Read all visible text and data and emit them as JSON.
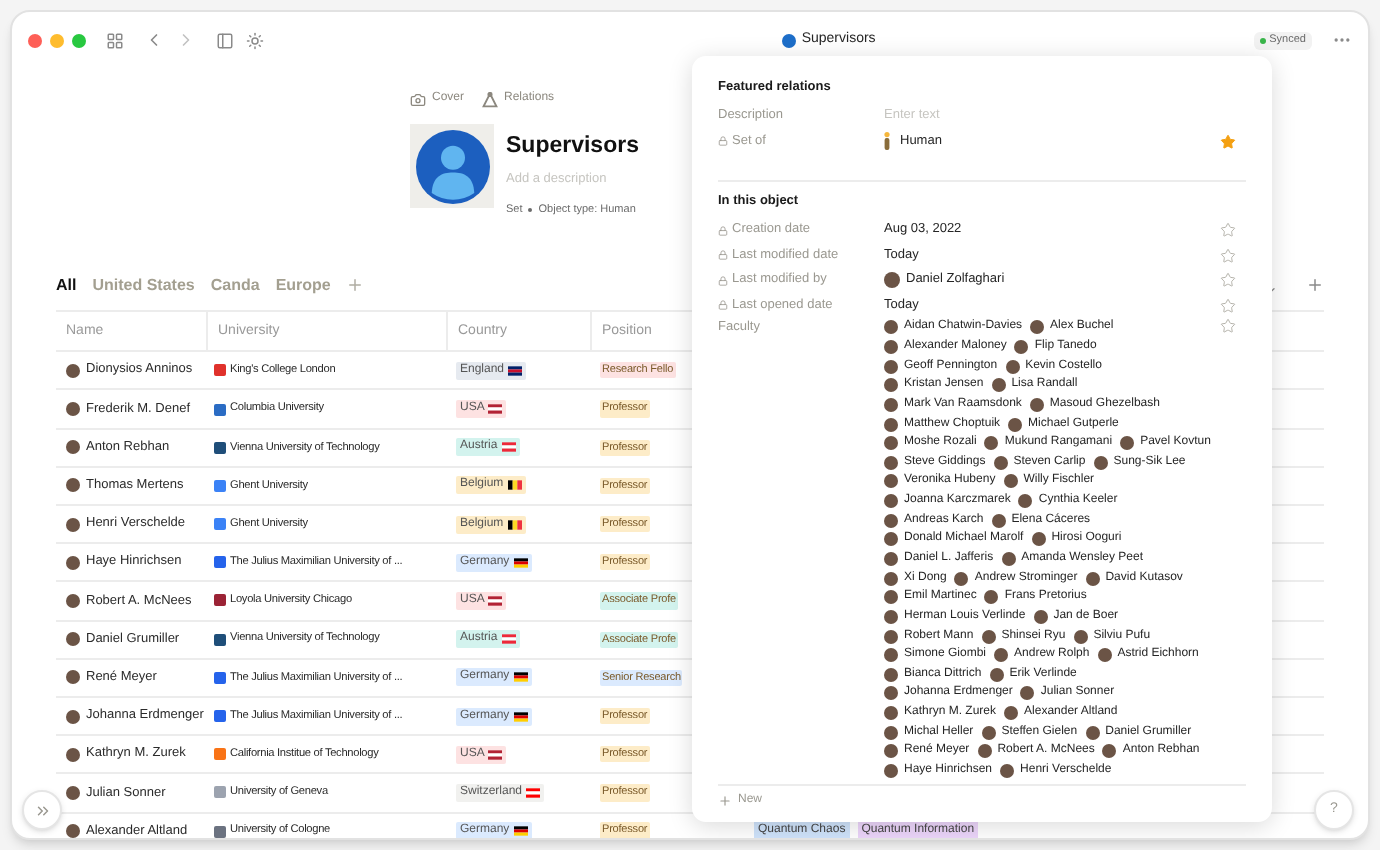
{
  "window": {
    "title": "Supervisors",
    "sync_status": "Synced"
  },
  "header": {
    "actions": [
      {
        "kind": "camera",
        "label": "Cover"
      },
      {
        "kind": "relations",
        "label": "Relations"
      }
    ],
    "title": "Supervisors",
    "description_placeholder": "Add a description",
    "type": "Set",
    "object_type": "Object type: Human"
  },
  "views": [
    {
      "label": "All",
      "selected": true
    },
    {
      "label": "United States",
      "selected": false
    },
    {
      "label": "Canda",
      "selected": false
    },
    {
      "label": "Europe",
      "selected": false
    }
  ],
  "table": {
    "columns": [
      "Name",
      "University",
      "Country",
      "Position"
    ],
    "rows": [
      {
        "name": "Dionysios Anninos",
        "university": {
          "label": "King's College London",
          "color": "#e0312b"
        },
        "country": {
          "label": "England",
          "color": "#e6eaf0",
          "flag": {
            "kind": "horizontal",
            "stripes": [
              {
                "color": "#012169"
              },
              {
                "color": "#c8102e"
              },
              {
                "color": "#012169"
              }
            ]
          }
        },
        "position": {
          "label": "Research Fello",
          "color": "#fde2e2"
        }
      },
      {
        "name": "Frederik M. Denef",
        "university": {
          "label": "Columbia University",
          "color": "#2a6cc4"
        },
        "country": {
          "label": "USA",
          "color": "#fde2e2",
          "flag": {
            "kind": "horizontal",
            "stripes": [
              {
                "color": "#b22234"
              },
              {
                "color": "#ffffff"
              },
              {
                "color": "#b22234"
              }
            ]
          }
        },
        "position": {
          "label": "Professor",
          "color": "#fdecc8"
        }
      },
      {
        "name": "Anton Rebhan",
        "university": {
          "label": "Vienna University of Technology",
          "color": "#1f4e79"
        },
        "country": {
          "label": "Austria",
          "color": "#d3f3ee",
          "flag": {
            "kind": "horizontal",
            "stripes": [
              {
                "color": "#ed2939"
              },
              {
                "color": "#ffffff"
              },
              {
                "color": "#ed2939"
              }
            ]
          }
        },
        "position": {
          "label": "Professor",
          "color": "#fdecc8"
        }
      },
      {
        "name": "Thomas Mertens",
        "university": {
          "label": "Ghent University",
          "color": "#3b82f6"
        },
        "country": {
          "label": "Belgium",
          "color": "#fdecc8",
          "flag": {
            "kind": "vertical",
            "stripes": [
              {
                "color": "#000000"
              },
              {
                "color": "#fdda24"
              },
              {
                "color": "#ef3340"
              }
            ]
          }
        },
        "position": {
          "label": "Professor",
          "color": "#fdecc8"
        }
      },
      {
        "name": "Henri Verschelde",
        "university": {
          "label": "Ghent University",
          "color": "#3b82f6"
        },
        "country": {
          "label": "Belgium",
          "color": "#fdecc8",
          "flag": {
            "kind": "vertical",
            "stripes": [
              {
                "color": "#000000"
              },
              {
                "color": "#fdda24"
              },
              {
                "color": "#ef3340"
              }
            ]
          }
        },
        "position": {
          "label": "Professor",
          "color": "#fdecc8"
        }
      },
      {
        "name": "Haye Hinrichsen",
        "university": {
          "label": "The Julius Maximilian University of ...",
          "color": "#2563eb"
        },
        "country": {
          "label": "Germany",
          "color": "#dbeafe",
          "flag": {
            "kind": "horizontal",
            "stripes": [
              {
                "color": "#000000"
              },
              {
                "color": "#dd0000"
              },
              {
                "color": "#ffce00"
              }
            ]
          }
        },
        "position": {
          "label": "Professor",
          "color": "#fdecc8"
        }
      },
      {
        "name": "Robert A. McNees",
        "university": {
          "label": "Loyola University Chicago",
          "color": "#9b2335"
        },
        "country": {
          "label": "USA",
          "color": "#fde2e2",
          "flag": {
            "kind": "horizontal",
            "stripes": [
              {
                "color": "#b22234"
              },
              {
                "color": "#ffffff"
              },
              {
                "color": "#b22234"
              }
            ]
          }
        },
        "position": {
          "label": "Associate Profe",
          "color": "#d3f3ee"
        }
      },
      {
        "name": "Daniel Grumiller",
        "university": {
          "label": "Vienna University of Technology",
          "color": "#1f4e79"
        },
        "country": {
          "label": "Austria",
          "color": "#d3f3ee",
          "flag": {
            "kind": "horizontal",
            "stripes": [
              {
                "color": "#ed2939"
              },
              {
                "color": "#ffffff"
              },
              {
                "color": "#ed2939"
              }
            ]
          }
        },
        "position": {
          "label": "Associate Profe",
          "color": "#d3f3ee"
        }
      },
      {
        "name": "René Meyer",
        "university": {
          "label": "The Julius Maximilian University of ...",
          "color": "#2563eb"
        },
        "country": {
          "label": "Germany",
          "color": "#dbeafe",
          "flag": {
            "kind": "horizontal",
            "stripes": [
              {
                "color": "#000000"
              },
              {
                "color": "#dd0000"
              },
              {
                "color": "#ffce00"
              }
            ]
          }
        },
        "position": {
          "label": "Senior Research",
          "color": "#dbeafe"
        }
      },
      {
        "name": "Johanna Erdmenger",
        "university": {
          "label": "The Julius Maximilian University of ...",
          "color": "#2563eb"
        },
        "country": {
          "label": "Germany",
          "color": "#dbeafe",
          "flag": {
            "kind": "horizontal",
            "stripes": [
              {
                "color": "#000000"
              },
              {
                "color": "#dd0000"
              },
              {
                "color": "#ffce00"
              }
            ]
          }
        },
        "position": {
          "label": "Professor",
          "color": "#fdecc8"
        }
      },
      {
        "name": "Kathryn M. Zurek",
        "university": {
          "label": "California Institue of Technology",
          "color": "#f97316"
        },
        "country": {
          "label": "USA",
          "color": "#fde2e2",
          "flag": {
            "kind": "horizontal",
            "stripes": [
              {
                "color": "#b22234"
              },
              {
                "color": "#ffffff"
              },
              {
                "color": "#b22234"
              }
            ]
          }
        },
        "position": {
          "label": "Professor",
          "color": "#fdecc8"
        }
      },
      {
        "name": "Julian Sonner",
        "university": {
          "label": "University of Geneva",
          "color": "#9ca3af"
        },
        "country": {
          "label": "Switzerland",
          "color": "#f1f1ef",
          "flag": {
            "kind": "horizontal",
            "stripes": [
              {
                "color": "#ff0000"
              },
              {
                "color": "#ffffff"
              },
              {
                "color": "#ff0000"
              }
            ]
          }
        },
        "position": {
          "label": "Professor",
          "color": "#fdecc8"
        }
      },
      {
        "name": "Alexander Altland",
        "university": {
          "label": "University of Cologne",
          "color": "#6b7280"
        },
        "country": {
          "label": "Germany",
          "color": "#dbeafe",
          "flag": {
            "kind": "horizontal",
            "stripes": [
              {
                "color": "#000000"
              },
              {
                "color": "#dd0000"
              },
              {
                "color": "#ffce00"
              }
            ]
          }
        },
        "position": {
          "label": "Professor",
          "color": "#fdecc8"
        },
        "tags": [
          {
            "label": "Quantum Chaos",
            "color": "#cfe3fb"
          },
          {
            "label": "Quantum Information",
            "color": "#ecd5fa"
          }
        ]
      }
    ]
  },
  "relations_panel": {
    "sections": [
      {
        "title": "Featured relations",
        "rows": [
          {
            "kind": "placeholder",
            "label": "Description",
            "locked": false,
            "value": "Enter text"
          },
          {
            "kind": "object",
            "label": "Set of",
            "locked": true,
            "value": "Human",
            "starred": true
          }
        ]
      },
      {
        "title": "In this object",
        "rows": [
          {
            "kind": "text",
            "label": "Creation date",
            "locked": true,
            "value": "Aug 03, 2022",
            "starred": false
          },
          {
            "kind": "text",
            "label": "Last modified date",
            "locked": true,
            "value": "Today",
            "starred": false
          },
          {
            "kind": "person",
            "label": "Last modified by",
            "locked": true,
            "value": "Daniel Zolfaghari",
            "starred": false
          },
          {
            "kind": "text",
            "label": "Last opened date",
            "locked": true,
            "value": "Today",
            "starred": false
          },
          {
            "kind": "people",
            "label": "Faculty",
            "locked": false,
            "starred": false,
            "lines": [
              [
                "Aidan Chatwin-Davies",
                "Alex Buchel"
              ],
              [
                "Alexander Maloney",
                "Flip Tanedo"
              ],
              [
                "Geoff Pennington",
                "Kevin Costello"
              ],
              [
                "Kristan Jensen",
                "Lisa Randall"
              ],
              [
                "Mark Van Raamsdonk",
                "Masoud Ghezelbash"
              ],
              [
                "Matthew Choptuik",
                "Michael Gutperle"
              ],
              [
                "Moshe Rozali",
                "Mukund Rangamani",
                "Pavel Kovtun"
              ],
              [
                "Steve Giddings",
                "Steven Carlip",
                "Sung-Sik Lee"
              ],
              [
                "Veronika Hubeny",
                "Willy Fischler"
              ],
              [
                "Joanna Karczmarek",
                "Cynthia Keeler"
              ],
              [
                "Andreas Karch",
                "Elena Cáceres"
              ],
              [
                "Donald Michael Marolf",
                "Hirosi Ooguri"
              ],
              [
                "Daniel L. Jafferis",
                "Amanda Wensley Peet"
              ],
              [
                "Xi Dong",
                "Andrew Strominger",
                "David Kutasov"
              ],
              [
                "Emil Martinec",
                "Frans Pretorius"
              ],
              [
                "Herman Louis Verlinde",
                "Jan de Boer"
              ],
              [
                "Robert Mann",
                "Shinsei Ryu",
                "Silviu Pufu"
              ],
              [
                "Simone Giombi",
                "Andrew Rolph",
                "Astrid Eichhorn"
              ],
              [
                "Bianca Dittrich",
                "Erik Verlinde"
              ],
              [
                "Johanna Erdmenger",
                "Julian Sonner"
              ],
              [
                "Kathryn M. Zurek",
                "Alexander Altland"
              ],
              [
                "Michal Heller",
                "Steffen Gielen",
                "Daniel Grumiller"
              ],
              [
                "René Meyer",
                "Robert A. McNees",
                "Anton Rebhan"
              ],
              [
                "Haye Hinrichsen",
                "Henri Verschelde"
              ]
            ]
          }
        ]
      }
    ],
    "new_button": "New"
  },
  "help_button": "?"
}
